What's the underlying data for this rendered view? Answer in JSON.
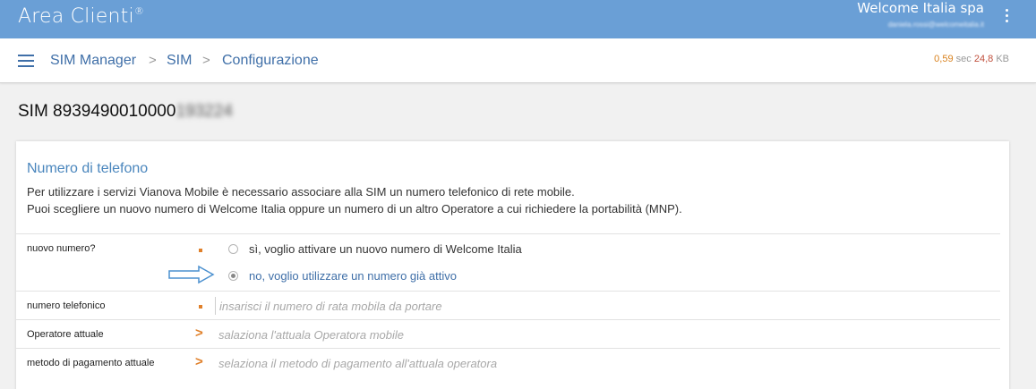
{
  "topbar": {
    "brand": "Area Clienti",
    "brand_mark": "®",
    "company": "Welcome Italia spa",
    "user_email": "daniela.rossi@welcomeitalia.it",
    "menu_icon": "kebab-vertical-icon"
  },
  "breadcrumb": {
    "menu_icon": "hamburger-icon",
    "items": [
      "SIM Manager",
      "SIM",
      "Configurazione"
    ],
    "separator": ">"
  },
  "performance": {
    "time": "0,59",
    "time_unit": "sec",
    "size": "24,8",
    "size_unit": "KB"
  },
  "sim": {
    "prefix": "SIM 8939490010000",
    "suffix_blurred": "193224"
  },
  "card": {
    "title": "Numero di telefono",
    "desc_line1": "Per utilizzare i servizi Vianova Mobile è necessario associare alla SIM un numero telefonico di rete mobile.",
    "desc_line2": "Puoi scegliere un nuovo numero di Welcome Italia oppure un numero di un altro Operatore a cui richiedere la portabilità (MNP).",
    "fields": {
      "new_number": {
        "label": "nuovo numero?",
        "options": [
          "sì, voglio attivare un nuovo numero di Welcome Italia",
          "no, voglio utilizzare un numero già attivo"
        ],
        "selected_index": 1
      },
      "phone": {
        "label": "numero telefonico",
        "placeholder": "insarisci il numero di rata mobila da portare"
      },
      "operator": {
        "label": "Operatore attuale",
        "placeholder": "salaziona l'attuala Operatora mobile"
      },
      "payment": {
        "label": "metodo di pagamento attuale",
        "placeholder": "selaziona il metodo di pagamento all'attuala operatora"
      }
    }
  },
  "colors": {
    "topbar": "#6a9fd6",
    "link": "#3f6fa8",
    "accent": "#e0802a",
    "title": "#4a86bd"
  }
}
